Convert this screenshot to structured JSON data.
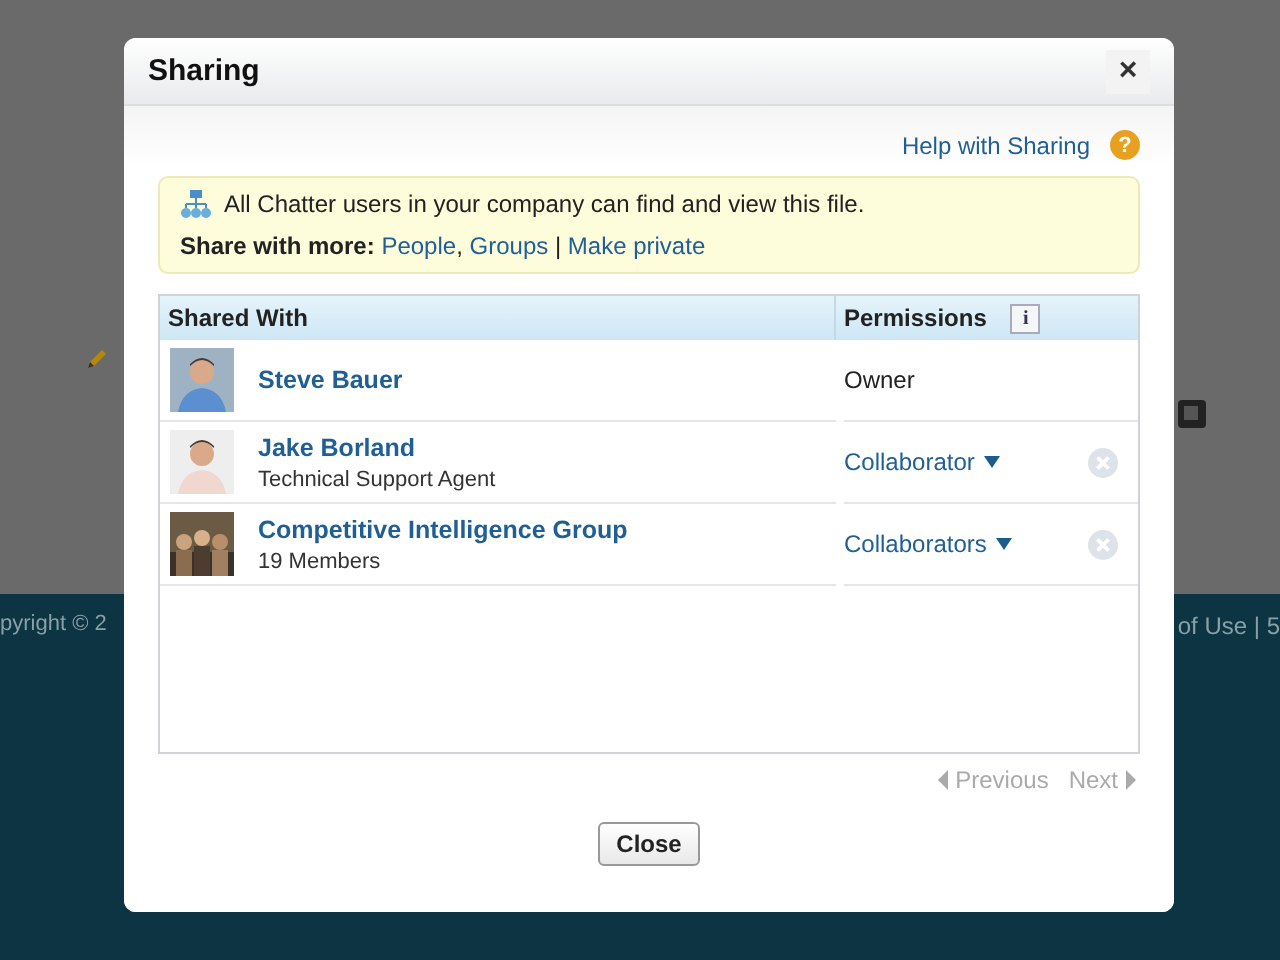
{
  "background": {
    "footer_left": "pyright © 2",
    "footer_right": "of Use | 5"
  },
  "window": {
    "title": "Sharing",
    "close": "×"
  },
  "help": {
    "link": "Help with Sharing",
    "badge": "?"
  },
  "notice": {
    "text": "All Chatter users in your company can find and view this file.",
    "share_label": "Share with more:",
    "links": [
      {
        "text": "People",
        "suffix": ","
      },
      {
        "text": "Groups",
        "suffix": " |"
      },
      {
        "text": "Make private"
      }
    ]
  },
  "table": {
    "columns": [
      "Shared With",
      "Permissions"
    ],
    "info_button": "i",
    "rows": [
      {
        "kind": "person",
        "name": "Steve Bauer",
        "permission": "Owner",
        "editable": false,
        "removable": false
      },
      {
        "kind": "person",
        "name": "Jake Borland",
        "subtitle": "Technical Support Agent",
        "permission": "Collaborator",
        "editable": true,
        "removable": true
      },
      {
        "kind": "group",
        "name": "Competitive Intelligence Group",
        "subtitle": "19 Members",
        "permission": "Collaborators",
        "editable": true,
        "removable": true
      }
    ]
  },
  "pagination": {
    "previous": {
      "label": "Previous",
      "disabled": true
    },
    "next": {
      "label": "Next",
      "disabled": true
    }
  },
  "buttons": [
    "Close"
  ]
}
